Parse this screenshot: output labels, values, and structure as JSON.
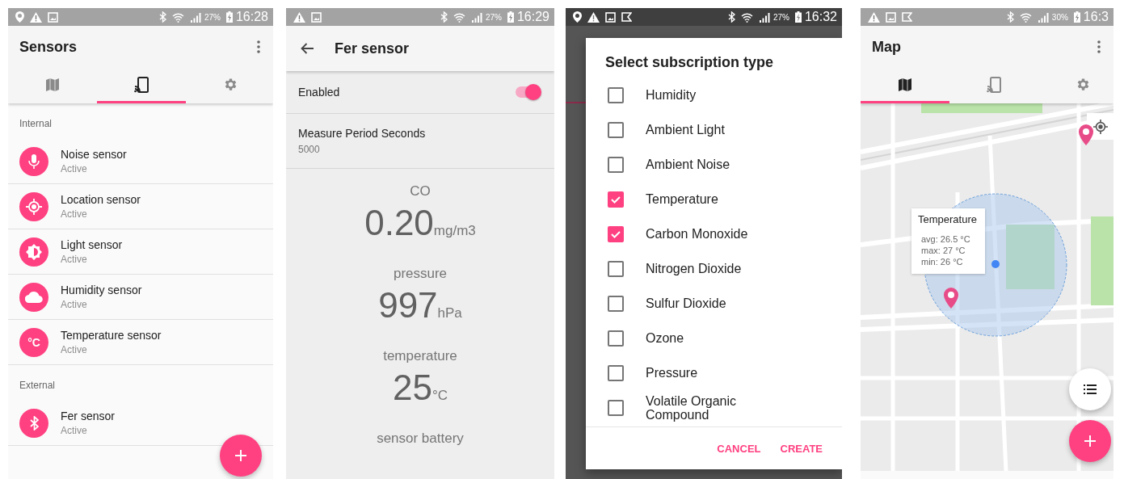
{
  "sensors_screen": {
    "status_bar": {
      "battery": "27%",
      "time": "16:28"
    },
    "title": "Sensors",
    "tabs": [
      {
        "kind": "map",
        "selected": false
      },
      {
        "kind": "sensors",
        "selected": true
      },
      {
        "kind": "settings",
        "selected": false
      }
    ],
    "sections": [
      {
        "header": "Internal",
        "items": [
          {
            "kind": "microphone",
            "name": "Noise sensor",
            "status": "Active"
          },
          {
            "kind": "location",
            "name": "Location sensor",
            "status": "Active"
          },
          {
            "kind": "brightness",
            "name": "Light sensor",
            "status": "Active"
          },
          {
            "kind": "cloud",
            "name": "Humidity sensor",
            "status": "Active"
          },
          {
            "kind": "celsius",
            "icon_text": "°C",
            "name": "Temperature sensor",
            "status": "Active"
          }
        ]
      },
      {
        "header": "External",
        "items": [
          {
            "kind": "bluetooth",
            "name": "Fer sensor",
            "status": "Active"
          }
        ]
      }
    ]
  },
  "fer_sensor_screen": {
    "status_bar": {
      "battery": "27%",
      "time": "16:29"
    },
    "title": "Fer sensor",
    "enabled": {
      "label": "Enabled",
      "on": true
    },
    "measure_period": {
      "label": "Measure Period Seconds",
      "value": "5000"
    },
    "readings": [
      {
        "label": "CO",
        "value": "0.20",
        "unit": "mg/m3"
      },
      {
        "label": "pressure",
        "value": "997",
        "unit": "hPa"
      },
      {
        "label": "temperature",
        "value": "25",
        "unit": "°C"
      },
      {
        "label": "sensor battery"
      }
    ]
  },
  "subscription_screen": {
    "status_bar": {
      "battery": "27%",
      "time": "16:32"
    },
    "dialog": {
      "title": "Select subscription type",
      "options": [
        {
          "label": "Humidity",
          "checked": false
        },
        {
          "label": "Ambient Light",
          "checked": false
        },
        {
          "label": "Ambient Noise",
          "checked": false
        },
        {
          "label": "Temperature",
          "checked": true
        },
        {
          "label": "Carbon Monoxide",
          "checked": true
        },
        {
          "label": "Nitrogen Dioxide",
          "checked": false
        },
        {
          "label": "Sulfur Dioxide",
          "checked": false
        },
        {
          "label": "Ozone",
          "checked": false
        },
        {
          "label": "Pressure",
          "checked": false
        },
        {
          "label": "Volatile Organic Compound",
          "checked": false
        }
      ],
      "buttons": [
        "CANCEL",
        "CREATE"
      ]
    }
  },
  "map_screen": {
    "status_bar": {
      "battery": "30%",
      "time": "16:3"
    },
    "title": "Map",
    "tabs": [
      {
        "kind": "map",
        "selected": true
      },
      {
        "kind": "sensors",
        "selected": false
      },
      {
        "kind": "settings",
        "selected": false
      }
    ],
    "info_window": {
      "title": "Temperature",
      "lines": [
        "avg: 26.5 °C",
        "max: 27 °C",
        "min: 26 °C"
      ]
    }
  }
}
